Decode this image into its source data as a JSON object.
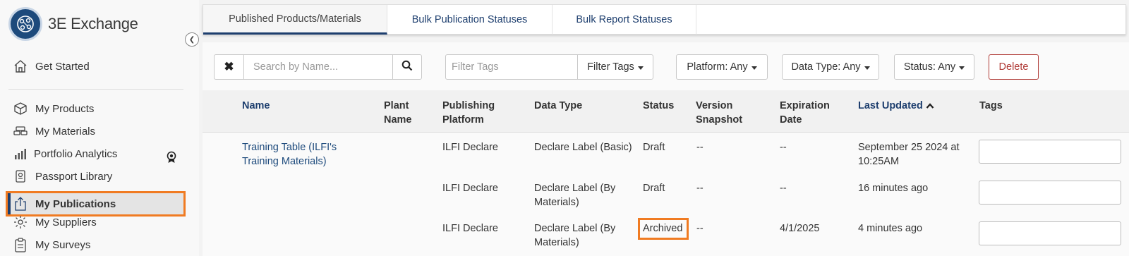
{
  "app": {
    "name": "3E Exchange"
  },
  "sidebar": {
    "items": [
      {
        "label": "Get Started",
        "icon": "home-icon"
      },
      {
        "label": "My Products",
        "icon": "box-icon"
      },
      {
        "label": "My Materials",
        "icon": "materials-icon"
      },
      {
        "label": "Portfolio Analytics",
        "icon": "bar-chart-icon"
      },
      {
        "label": "Passport Library",
        "icon": "passport-icon"
      },
      {
        "label": "My Publications",
        "icon": "upload-icon",
        "active": true
      },
      {
        "label": "My Suppliers",
        "icon": "gear-icon"
      },
      {
        "label": "My Surveys",
        "icon": "clipboard-icon"
      }
    ]
  },
  "tabs": [
    {
      "label": "Published Products/Materials",
      "active": true
    },
    {
      "label": "Bulk Publication Statuses"
    },
    {
      "label": "Bulk Report Statuses"
    }
  ],
  "toolbar": {
    "search_placeholder": "Search by Name...",
    "tags_placeholder": "Filter Tags",
    "filter_tags_label": "Filter Tags",
    "platform_label": "Platform: Any",
    "data_type_label": "Data Type: Any",
    "status_label": "Status: Any",
    "delete_label": "Delete"
  },
  "table": {
    "columns": {
      "name": "Name",
      "plant_name_1": "Plant",
      "plant_name_2": "Name",
      "platform_1": "Publishing",
      "platform_2": "Platform",
      "data_type": "Data Type",
      "status": "Status",
      "version_1": "Version",
      "version_2": "Snapshot",
      "expiration_1": "Expiration",
      "expiration_2": "Date",
      "last_updated": "Last Updated",
      "tags": "Tags"
    },
    "rows": [
      {
        "name_1": "Training Table (ILFI's",
        "name_2": "Training Materials)",
        "platform": "ILFI Declare",
        "data_type_1": "Declare Label (Basic)",
        "data_type_2": "",
        "status": "Draft",
        "version": "--",
        "expiration": "--",
        "updated_1": "September 25 2024 at",
        "updated_2": "10:25AM"
      },
      {
        "name_1": "",
        "name_2": "",
        "platform": "ILFI Declare",
        "data_type_1": "Declare Label (By",
        "data_type_2": "Materials)",
        "status": "Draft",
        "version": "--",
        "expiration": "--",
        "updated_1": "16 minutes ago",
        "updated_2": ""
      },
      {
        "name_1": "",
        "name_2": "",
        "platform": "ILFI Declare",
        "data_type_1": "Declare Label (By",
        "data_type_2": "Materials)",
        "status": "Archived",
        "version": "--",
        "expiration": "4/1/2025",
        "updated_1": "4 minutes ago",
        "updated_2": ""
      }
    ]
  },
  "colors": {
    "accent": "#1d3e6e",
    "highlight": "#f07b22",
    "danger": "#b03a36"
  }
}
